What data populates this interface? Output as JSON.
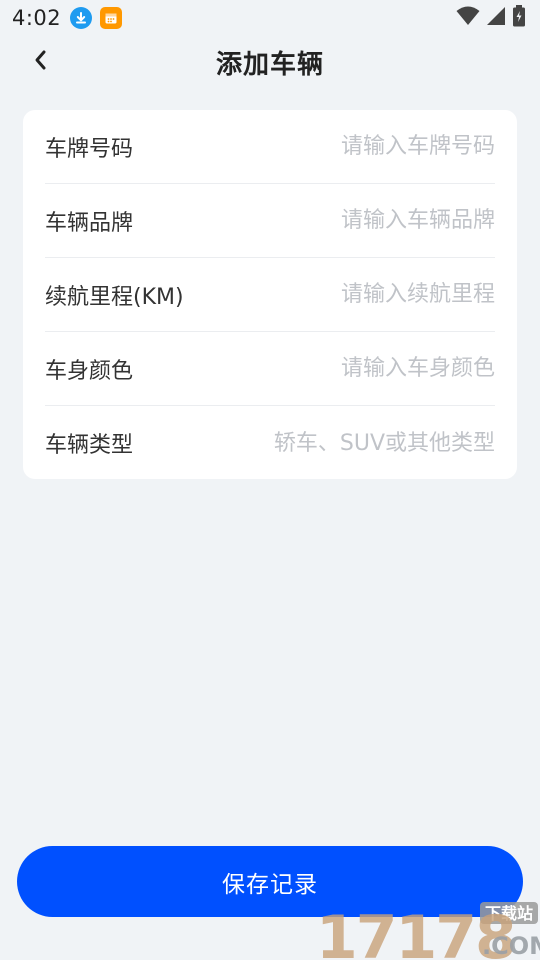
{
  "status_bar": {
    "time": "4:02",
    "icons": [
      "download-icon",
      "calendar-icon",
      "wifi-icon",
      "signal-icon",
      "battery-icon"
    ]
  },
  "header": {
    "title": "添加车辆",
    "back_icon": "chevron-left-icon"
  },
  "form": {
    "fields": [
      {
        "label": "车牌号码",
        "placeholder": "请输入车牌号码",
        "value": ""
      },
      {
        "label": "车辆品牌",
        "placeholder": "请输入车辆品牌",
        "value": ""
      },
      {
        "label": "续航里程(KM)",
        "placeholder": "请输入续航里程",
        "value": ""
      },
      {
        "label": "车身颜色",
        "placeholder": "请输入车身颜色",
        "value": ""
      },
      {
        "label": "车辆类型",
        "placeholder": "轿车、SUV或其他类型",
        "value": ""
      }
    ]
  },
  "footer": {
    "save_label": "保存记录"
  },
  "watermark": {
    "number": "17178",
    "tag": "下载站",
    "domain": ".COM"
  },
  "colors": {
    "background": "#f0f3f6",
    "card": "#ffffff",
    "primary": "#0050ff",
    "placeholder": "#c0c3c8",
    "download_badge": "#1e9bf0",
    "calendar_badge": "#ff9800"
  }
}
